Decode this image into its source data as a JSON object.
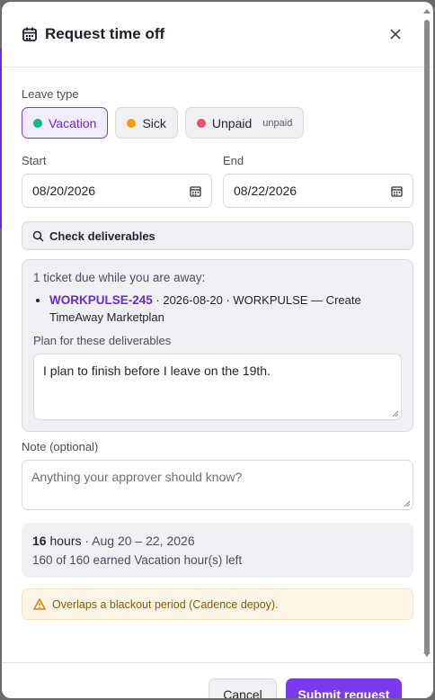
{
  "dialog": {
    "title": "Request time off",
    "icon": "calendar-icon",
    "close_icon": "close-icon"
  },
  "leave_type": {
    "label": "Leave type",
    "options": [
      {
        "label": "Vacation",
        "color": "#10b981",
        "selected": true,
        "sub": ""
      },
      {
        "label": "Sick",
        "color": "#f59e0b",
        "selected": false,
        "sub": ""
      },
      {
        "label": "Unpaid",
        "color": "#ef4f6e",
        "selected": false,
        "sub": "unpaid"
      }
    ]
  },
  "dates": {
    "start_label": "Start",
    "start_value": "08/20/2026",
    "end_label": "End",
    "end_value": "08/22/2026"
  },
  "deliverables": {
    "check_label": "Check deliverables",
    "summary": "1 ticket due while you are away:",
    "tickets": [
      {
        "key": "WORKPULSE-245",
        "rest": " · 2026-08-20 · WORKPULSE — Create TimeAway Marketplan"
      }
    ],
    "plan_label": "Plan for these deliverables",
    "plan_value": "I plan to finish before I leave on the 19th."
  },
  "note": {
    "label": "Note (optional)",
    "placeholder": "Anything your approver should know?"
  },
  "summary": {
    "hours_number": "16",
    "hours_unit": " hours",
    "range": " · Aug 20 – 22, 2026",
    "balance": "160 of 160 earned Vacation hour(s) left"
  },
  "warning": {
    "text": "Overlaps a blackout period (Cadence depoy)."
  },
  "footer": {
    "cancel_label": "Cancel",
    "submit_label": "Submit request"
  },
  "colors": {
    "accent": "#7c3aed",
    "warning": "#d97706"
  }
}
